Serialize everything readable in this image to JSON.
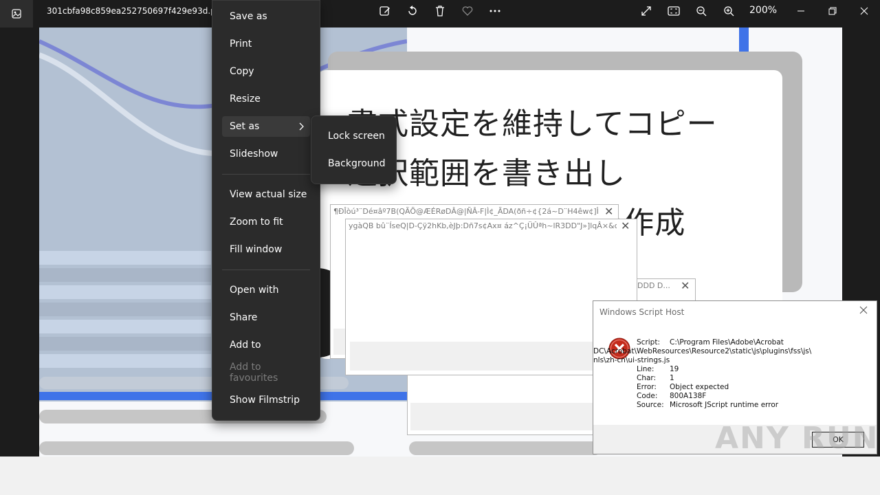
{
  "titlebar": {
    "file_name": "301cbfa98c859ea252750697f429e93d.png",
    "zoom": "200%",
    "toolbar_icons": [
      "edit-icon",
      "rotate-icon",
      "delete-icon",
      "favorite-icon",
      "more-icon"
    ],
    "view_icons": [
      "fullscreen-icon",
      "fit-icon",
      "zoom-out-icon",
      "zoom-in-icon"
    ]
  },
  "image": {
    "jp_lines": [
      "書式設定を維持してコピー",
      "選択範囲を書き出し",
      "テキストボックスを作成"
    ]
  },
  "context_menu": {
    "items": [
      "Save as",
      "Print",
      "Copy",
      "Resize",
      "Set as",
      "Slideshow",
      "View actual size",
      "Zoom to fit",
      "Fill window",
      "Open with",
      "Share",
      "Add to",
      "Add to favourites",
      "Show Filmstrip"
    ],
    "submenu": [
      "Lock screen",
      "Background"
    ]
  },
  "dialogs": {
    "garbled1": "¶ÐÎòú³¨Dé¤âº7B(QÃÕ@ÆÉRøDÂ@|ÑÂ-F|Ì¢_ÃDA(ðñ÷¢{2á~D¨H4êw¢]Î³rk...",
    "garbled2": "ygàQB  bû¨ÍseQ|D-Çÿ2hKb,èJþ:Dñ7s¢Ax¤  áz^Ç¡ÜÛªh~lR3DD\"J»]lqÂ×&c...",
    "garbled3": "DDD  D..."
  },
  "wsh": {
    "title": "Windows Script Host",
    "rows": [
      {
        "k": "Script:",
        "v": "C:\\Program Files\\Adobe\\Acrobat"
      },
      {
        "k": "",
        "v": "DC\\Acrobat\\WebResources\\Resource2\\static\\js\\plugins\\fss\\js\\"
      },
      {
        "k": "",
        "v": "nls\\zh-cn\\ui-strings.js"
      },
      {
        "k": "Line:",
        "v": "19"
      },
      {
        "k": "Char:",
        "v": "1"
      },
      {
        "k": "Error:",
        "v": "Object expected"
      },
      {
        "k": "Code:",
        "v": "800A138F"
      },
      {
        "k": "Source:",
        "v": "Microsoft JScript runtime error"
      }
    ],
    "ok_label": "OK"
  },
  "watermark": "ANY RUN",
  "colors": {
    "accent_blue": "#3f73e8",
    "error_red": "#c42b1c"
  }
}
